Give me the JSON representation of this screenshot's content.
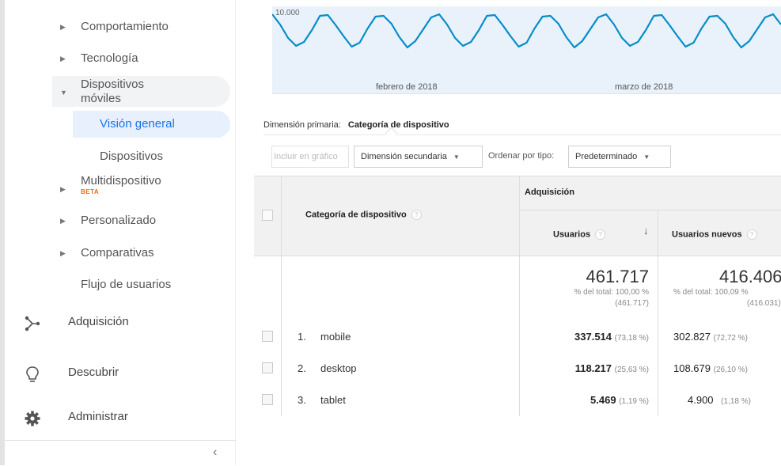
{
  "sidebar": {
    "items": [
      {
        "label": "Comportamiento"
      },
      {
        "label": "Tecnología"
      },
      {
        "label": "Dispositivos móviles"
      },
      {
        "label": "Multidispositivo",
        "badge": "BETA"
      },
      {
        "label": "Personalizado"
      },
      {
        "label": "Comparativas"
      },
      {
        "label": "Flujo de usuarios"
      }
    ],
    "sub_items": [
      {
        "label": "Visión general"
      },
      {
        "label": "Dispositivos"
      }
    ],
    "main_sections": [
      {
        "label": "Adquisición",
        "icon": "acquisition-icon"
      },
      {
        "label": "Descubrir",
        "icon": "lightbulb-icon"
      },
      {
        "label": "Administrar",
        "icon": "gear-icon"
      }
    ],
    "collapse_glyph": "‹"
  },
  "chart": {
    "y_tick": "10.000",
    "x_labels": [
      "febrero de 2018",
      "marzo de 2018"
    ],
    "line_color": "#058dc7",
    "fill_color": "#e9f1fb"
  },
  "report": {
    "primary_dimension_label": "Dimensión primaria:",
    "primary_dimension_value": "Categoría de dispositivo",
    "include_in_chart": "Incluir en gráfico",
    "secondary_dimension": "Dimensión secundaria",
    "sort_type_label": "Ordenar por tipo:",
    "sort_type_value": "Predeterminado"
  },
  "table": {
    "col_dimension": "Categoría de dispositivo",
    "group_header": "Adquisición",
    "col_users": "Usuarios",
    "col_new_users": "Usuarios nuevos",
    "help_glyph": "?",
    "sort_glyph": "↓",
    "totals": {
      "users": "461.717",
      "users_sub1": "% del total: 100,00 %",
      "users_sub2": "(461.717)",
      "new_users": "416.406",
      "new_users_sub1": "% del total: 100,09 %",
      "new_users_sub2": "(416.031)"
    },
    "rows": [
      {
        "num": "1.",
        "device": "mobile",
        "users": "337.514",
        "users_pct": "(73,18 %)",
        "new_users": "302.827",
        "new_users_pct": "(72,72 %)"
      },
      {
        "num": "2.",
        "device": "desktop",
        "users": "118.217",
        "users_pct": "(25,63 %)",
        "new_users": "108.679",
        "new_users_pct": "(26,10 %)"
      },
      {
        "num": "3.",
        "device": "tablet",
        "users": "5.469",
        "users_pct": "(1,19 %)",
        "new_users": "4.900",
        "new_users_pct": "(1,18 %)"
      }
    ]
  }
}
